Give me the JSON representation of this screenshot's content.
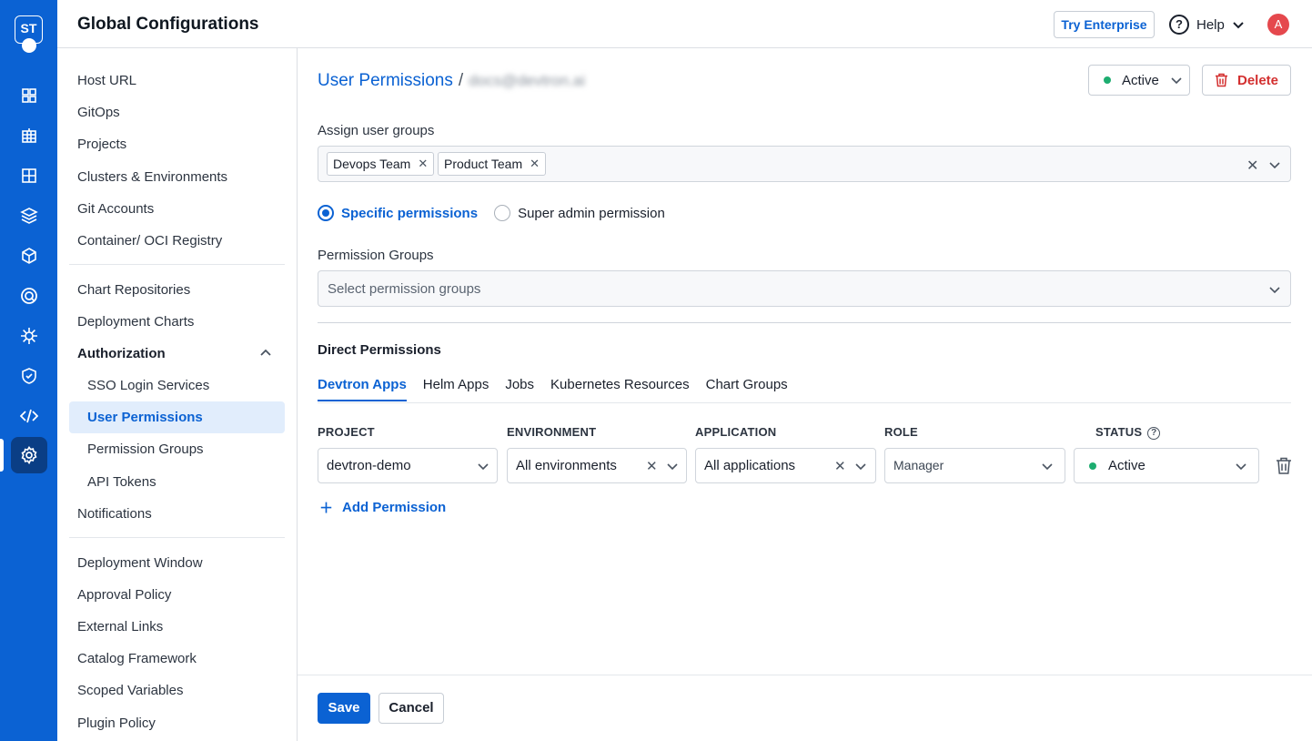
{
  "app": {
    "logo_text": "ST",
    "rail_icons": [
      "overview-icon",
      "apps-icon",
      "app-grid-icon",
      "stack-icon",
      "cube-icon",
      "target-icon",
      "helm-icon",
      "shield-check-icon",
      "code-icon",
      "settings-icon"
    ]
  },
  "header": {
    "title": "Global Configurations",
    "try_enterprise": "Try Enterprise",
    "help": "Help",
    "avatar": "A"
  },
  "nav": {
    "items": [
      "Host URL",
      "GitOps",
      "Projects",
      "Clusters & Environments",
      "Git Accounts",
      "Container/ OCI Registry",
      "Chart Repositories",
      "Deployment Charts",
      "Authorization",
      "SSO Login Services",
      "User Permissions",
      "Permission Groups",
      "API Tokens",
      "Notifications",
      "Deployment Window",
      "Approval Policy",
      "External Links",
      "Catalog Framework",
      "Scoped Variables",
      "Plugin Policy"
    ]
  },
  "main": {
    "breadcrumb_root": "User Permissions",
    "breadcrumb_sep": "/",
    "user_email": "docs@devtron.ai",
    "status": "Active",
    "delete": "Delete",
    "assign_label": "Assign user groups",
    "groups": [
      "Devops Team",
      "Product Team"
    ],
    "radio_specific": "Specific permissions",
    "radio_super": "Super admin permission",
    "perm_groups_label": "Permission Groups",
    "perm_groups_placeholder": "Select permission groups",
    "direct_title": "Direct Permissions",
    "tabs": [
      "Devtron Apps",
      "Helm Apps",
      "Jobs",
      "Kubernetes Resources",
      "Chart Groups"
    ],
    "columns": [
      "PROJECT",
      "ENVIRONMENT",
      "APPLICATION",
      "ROLE",
      "STATUS"
    ],
    "row": {
      "project": "devtron-demo",
      "environment": "All environments",
      "application": "All applications",
      "role": "Manager",
      "status": "Active"
    },
    "add_permission": "Add Permission",
    "save": "Save",
    "cancel": "Cancel"
  },
  "colors": {
    "brand": "#0b62d3",
    "active_dot": "#1dad70",
    "danger": "#d32f2f"
  }
}
